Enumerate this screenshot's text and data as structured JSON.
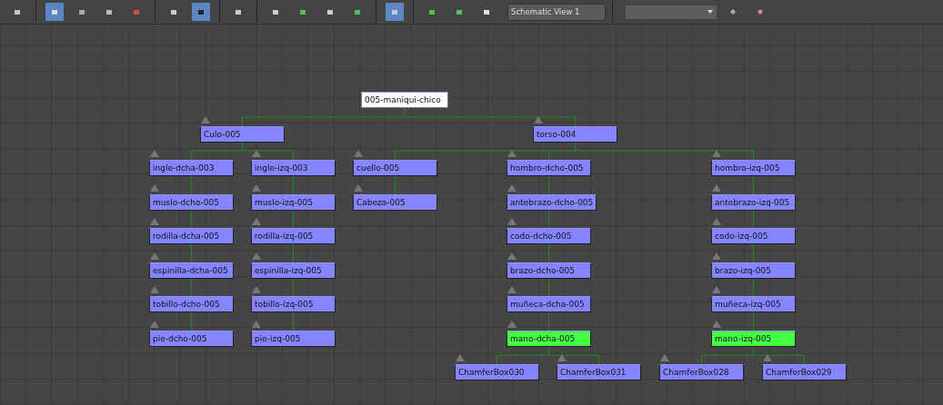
{
  "toolbar": {
    "tools": [
      {
        "selected": false
      },
      {
        "selected": true
      },
      {
        "selected": false
      },
      {
        "selected": false
      },
      {
        "selected": false
      },
      {
        "selected": false
      },
      {
        "selected": true
      },
      {
        "selected": false
      },
      {
        "selected": false
      },
      {
        "selected": false
      },
      {
        "selected": false
      },
      {
        "selected": false
      },
      {
        "selected": true
      },
      {
        "selected": false
      },
      {
        "selected": false
      },
      {
        "selected": false
      }
    ],
    "view_name": "Schematic View 1",
    "extra_tools": [
      {
        "selected": false
      },
      {
        "selected": false
      }
    ]
  },
  "schematic": {
    "root": {
      "label": "005-maniqui-chico",
      "selected": true,
      "children": [
        {
          "label": "Culo-005",
          "selected": false,
          "highlighted": false,
          "children": [
            {
              "label": "ingle-dcha-003",
              "selected": false,
              "highlighted": false,
              "children": [
                {
                  "label": "muslo-dcho-005",
                  "selected": false,
                  "highlighted": false,
                  "children": [
                    {
                      "label": "rodilla-dcha-005",
                      "selected": false,
                      "highlighted": false,
                      "children": [
                        {
                          "label": "espinilla-dcha-005",
                          "selected": false,
                          "highlighted": false,
                          "children": [
                            {
                              "label": "tobillo-dcho-005",
                              "selected": false,
                              "highlighted": false,
                              "children": [
                                {
                                  "label": "pie-dcho-005",
                                  "selected": false,
                                  "highlighted": false
                                }
                              ]
                            }
                          ]
                        }
                      ]
                    }
                  ]
                }
              ]
            },
            {
              "label": "ingle-izq-003",
              "selected": false,
              "highlighted": false,
              "children": [
                {
                  "label": "muslo-izq-005",
                  "selected": false,
                  "highlighted": false,
                  "children": [
                    {
                      "label": "rodilla-izq-005",
                      "selected": false,
                      "highlighted": false,
                      "children": [
                        {
                          "label": "espinilla-izq-005",
                          "selected": false,
                          "highlighted": false,
                          "children": [
                            {
                              "label": "tobillo-izq-005",
                              "selected": false,
                              "highlighted": false,
                              "children": [
                                {
                                  "label": "pie-izq-005",
                                  "selected": false,
                                  "highlighted": false
                                }
                              ]
                            }
                          ]
                        }
                      ]
                    }
                  ]
                }
              ]
            }
          ]
        },
        {
          "label": "torso-004",
          "selected": false,
          "highlighted": false,
          "children": [
            {
              "label": "cuello-005",
              "selected": false,
              "highlighted": false,
              "children": [
                {
                  "label": "Cabeza-005",
                  "selected": false,
                  "highlighted": false
                }
              ]
            },
            {
              "label": "hombro-dcho-005",
              "selected": false,
              "highlighted": false,
              "children": [
                {
                  "label": "antebrazo-dcho-005",
                  "selected": false,
                  "highlighted": false,
                  "children": [
                    {
                      "label": "codo-dcho-005",
                      "selected": false,
                      "highlighted": false,
                      "children": [
                        {
                          "label": "brazo-dcho-005",
                          "selected": false,
                          "highlighted": false,
                          "children": [
                            {
                              "label": "muñeca-dcha-005",
                              "selected": false,
                              "highlighted": false,
                              "children": [
                                {
                                  "label": "mano-dcha-005",
                                  "selected": false,
                                  "highlighted": true,
                                  "children": [
                                    {
                                      "label": "ChamferBox030",
                                      "selected": false,
                                      "highlighted": false
                                    },
                                    {
                                      "label": "ChamferBox031",
                                      "selected": false,
                                      "highlighted": false
                                    }
                                  ]
                                }
                              ]
                            }
                          ]
                        }
                      ]
                    }
                  ]
                }
              ]
            },
            {
              "label": "hombro-izq-005",
              "selected": false,
              "highlighted": false,
              "children": [
                {
                  "label": "antebrazo-izq-005",
                  "selected": false,
                  "highlighted": false,
                  "children": [
                    {
                      "label": "codo-izq-005",
                      "selected": false,
                      "highlighted": false,
                      "children": [
                        {
                          "label": "brazo-izq-005",
                          "selected": false,
                          "highlighted": false,
                          "children": [
                            {
                              "label": "muñeca-izq-005",
                              "selected": false,
                              "highlighted": false,
                              "children": [
                                {
                                  "label": "mano-izq-005",
                                  "selected": false,
                                  "highlighted": true,
                                  "children": [
                                    {
                                      "label": "ChamferBox028",
                                      "selected": false,
                                      "highlighted": false
                                    },
                                    {
                                      "label": "ChamferBox029",
                                      "selected": false,
                                      "highlighted": false
                                    }
                                  ]
                                }
                              ]
                            }
                          ]
                        }
                      ]
                    }
                  ]
                }
              ]
            }
          ]
        }
      ]
    }
  }
}
